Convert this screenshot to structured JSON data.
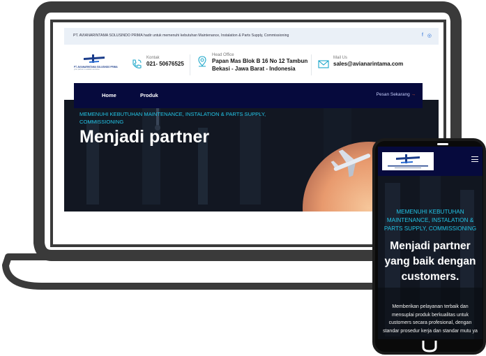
{
  "topbar": {
    "text": "PT. AVIANARINTAMA SOLUSINDO PRIMA hadir untuk memenuhi kebutuhan Maintenance, Instalation & Parts Supply, Commissioning",
    "social_facebook": "f",
    "social_instagram": "◎"
  },
  "contacts": {
    "phone_label": "Kontak",
    "phone_value": "021- 50676525",
    "office_label": "Head Office",
    "office_line1": "Papan Mas Blok B 16 No 12 Tambun",
    "office_line2": "Bekasi - Jawa Barat - Indonesia",
    "mail_label": "Mail Us",
    "mail_value": "sales@avianarintama.com"
  },
  "logo": {
    "name": "PT. AVIANARINTAMA SOLUSINDO PRIMA",
    "tagline": "your partner in aviation services"
  },
  "nav": {
    "items": [
      "Home",
      "Produk"
    ],
    "cta": "Pesan Sekarang",
    "cta_arrow": "→"
  },
  "hero": {
    "kicker": "MEMENUHI KEBUTUHAN MAINTENANCE, INSTALATION & PARTS SUPPLY, COMMISSIONING",
    "title_visible": "Menjadi partner"
  },
  "mobile": {
    "kicker": "MEMENUHI KEBUTUHAN MAINTENANCE, INSTALATION & PARTS SUPPLY, COMMISSIONING",
    "title": "Menjadi partner yang baik dengan customers.",
    "description": "Memberikan pelayanan terbaik dan mensuplai produk berkualitas untuk customers secara profesional, dengan standar prosedur kerja dan standar mutu ya"
  },
  "colors": {
    "navy": "#060a3d",
    "accent_cyan": "#22c4e6",
    "device_frame": "#3a3a3a",
    "cta_arrow": "#e4572e"
  }
}
